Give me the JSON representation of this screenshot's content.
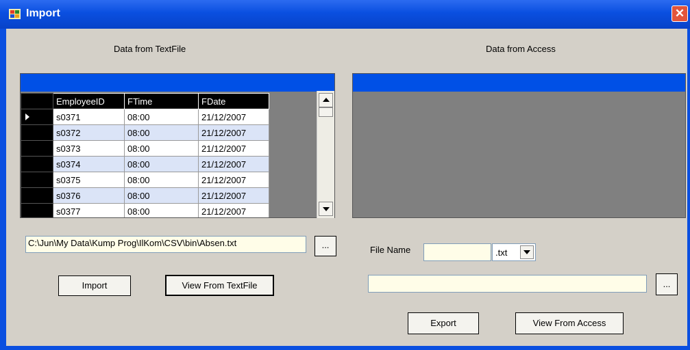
{
  "window": {
    "title": "Import",
    "close_glyph": "✕"
  },
  "left": {
    "heading": "Data from TextFile",
    "grid": {
      "columns": [
        "EmployeeID",
        "FTime",
        "FDate"
      ],
      "rows": [
        [
          "s0371",
          "08:00",
          "21/12/2007"
        ],
        [
          "s0372",
          "08:00",
          "21/12/2007"
        ],
        [
          "s0373",
          "08:00",
          "21/12/2007"
        ],
        [
          "s0374",
          "08:00",
          "21/12/2007"
        ],
        [
          "s0375",
          "08:00",
          "21/12/2007"
        ],
        [
          "s0376",
          "08:00",
          "21/12/2007"
        ],
        [
          "s0377",
          "08:00",
          "21/12/2007"
        ]
      ]
    },
    "file_path": "C:\\Jun\\My Data\\Kump Prog\\IlKom\\CSV\\bin\\Absen.txt",
    "browse_label": "...",
    "import_label": "Import",
    "view_label": "View From TextFile"
  },
  "right": {
    "heading": "Data from Access",
    "file_name_label": "File Name",
    "file_name_value": "",
    "extension": ".txt",
    "path_value": "",
    "browse_label": "...",
    "export_label": "Export",
    "view_label": "View From Access"
  },
  "icons": {
    "app": "app-window-icon",
    "close": "close-icon",
    "scroll_up": "scroll-up-icon",
    "scroll_down": "scroll-down-icon",
    "dropdown": "chevron-down-icon",
    "row_pointer": "current-row-icon"
  },
  "colors": {
    "titlebar": "#0a4fe0",
    "grid_caption": "#0050e6",
    "grid_background": "#808080",
    "alt_row": "#dbe4f7",
    "textbox": "#fffde8",
    "form": "#d4d0c8"
  }
}
